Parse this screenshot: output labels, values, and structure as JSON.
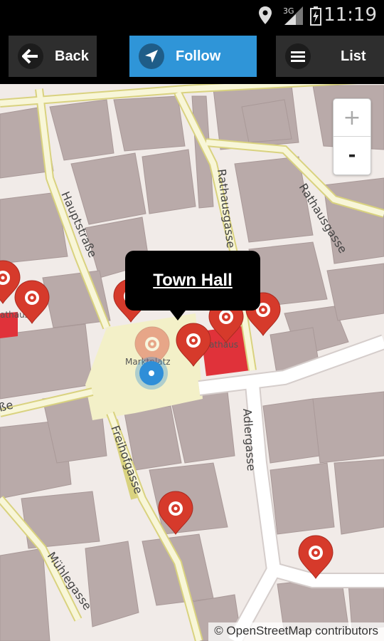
{
  "status_bar": {
    "network": "3G",
    "time": "11:19",
    "icons": [
      "location-icon",
      "signal-icon",
      "battery-icon"
    ]
  },
  "toolbar": {
    "back_label": "Back",
    "follow_label": "Follow",
    "list_label": "List",
    "active_button": "follow",
    "accent_color": "#2f95d8"
  },
  "map": {
    "streets": [
      "Hauptstraße",
      "Rathausgasse",
      "Rathausgasse",
      "Freihofgasse",
      "Adlergasse",
      "Mühlegasse",
      "ße"
    ],
    "places": [
      "Marktplatz",
      "Rathaus",
      "Rathaus"
    ],
    "popup_title": "Town Hall",
    "zoom_in_label": "+",
    "zoom_out_label": "-",
    "attribution": "© OpenStreetMap contributors",
    "marker_color": "#d63a2b",
    "location_color": "#2f8ed8"
  }
}
